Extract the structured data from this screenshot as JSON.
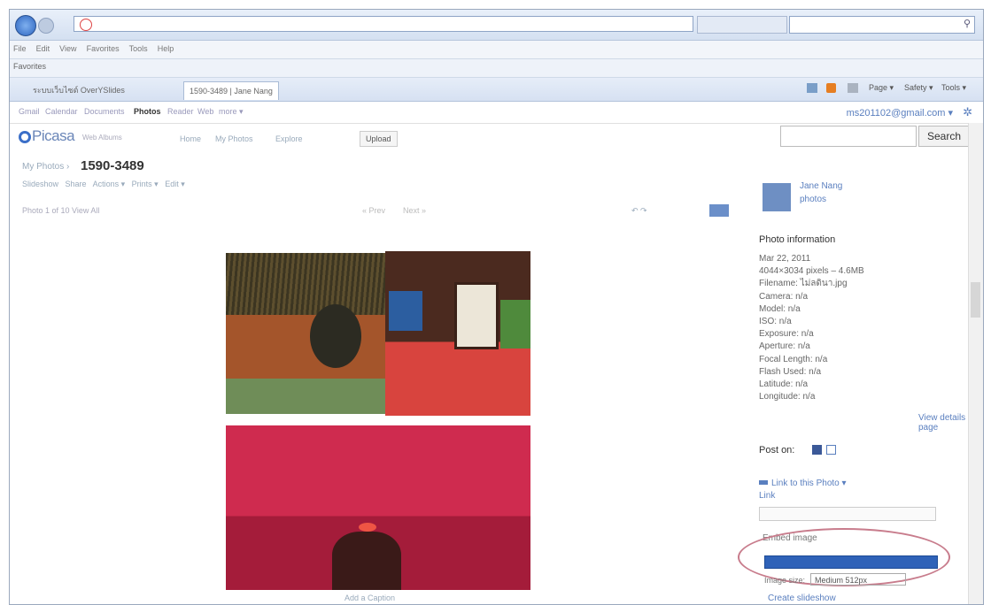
{
  "browser": {
    "menu": [
      "File",
      "Edit",
      "View",
      "Favorites",
      "Tools",
      "Help"
    ],
    "favorites_label": "Favorites",
    "tabs": [
      "ระบบเว็บไซต์ OverYSlides",
      "1590-3489 | Jane Nang"
    ],
    "commands": [
      "Page ▾",
      "Safety ▾",
      "Tools ▾"
    ]
  },
  "google_bar": {
    "links": [
      "Gmail",
      "Calendar",
      "Documents",
      "Photos",
      "Reader",
      "Web",
      "more ▾"
    ],
    "account": "ms201102@gmail.com ▾"
  },
  "picasa": {
    "logo": "Picasa",
    "logo_sub": "Web Albums",
    "nav": [
      "Home",
      "My Photos",
      "Explore"
    ],
    "upload": "Upload",
    "search_button": "Search"
  },
  "album": {
    "breadcrumb": "My Photos ›",
    "title": "1590-3489",
    "tools": [
      "Slideshow",
      "Share",
      "Actions ▾",
      "Prints ▾",
      "Edit ▾"
    ],
    "pager": "Photo 1 of 10  View All",
    "prev": "« Prev",
    "next": "Next »",
    "caption": "Add a Caption"
  },
  "sidebar": {
    "owner_name": "Jane Nang",
    "owner_photos": "photos",
    "info_heading": "Photo information",
    "info_lines": [
      "Mar 22, 2011",
      "4044×3034 pixels – 4.6MB",
      "Filename: ไม่ลดินา.jpg",
      "Camera: n/a",
      "Model: n/a",
      "ISO: n/a",
      "Exposure: n/a",
      "Aperture: n/a",
      "Focal Length: n/a",
      "Flash Used: n/a",
      "Latitude: n/a",
      "Longitude: n/a"
    ],
    "details_link": "View details page",
    "post_on": "Post on:",
    "link_heading": "Link to this Photo ▾",
    "url_label": "Link",
    "embed_label": "Embed image",
    "size_label": "Image size:",
    "size_value": "Medium 512px",
    "slideshow_link": "Create slideshow"
  }
}
